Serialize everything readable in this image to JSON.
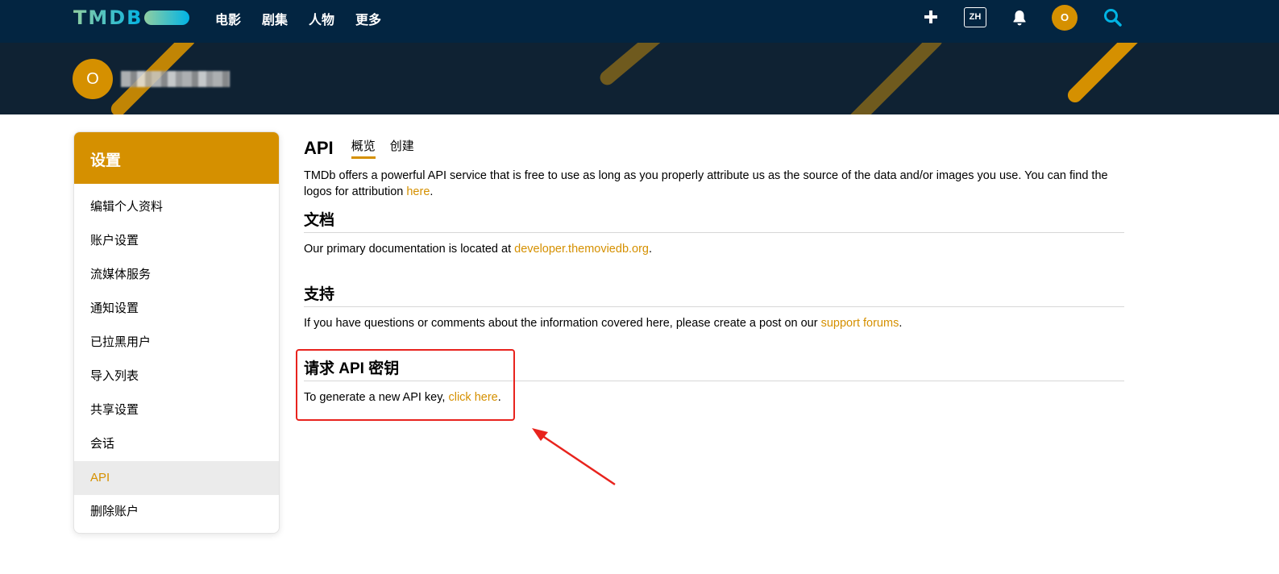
{
  "topnav": {
    "logo": "TMDB",
    "menu": [
      "电影",
      "剧集",
      "人物",
      "更多"
    ],
    "lang": "ZH",
    "avatar_initial": "O",
    "icons": [
      "plus-icon",
      "bell-icon",
      "search-icon"
    ]
  },
  "banner": {
    "avatar_initial": "O"
  },
  "sidebar": {
    "title": "设置",
    "items": [
      {
        "label": "编辑个人资料"
      },
      {
        "label": "账户设置"
      },
      {
        "label": "流媒体服务"
      },
      {
        "label": "通知设置"
      },
      {
        "label": "已拉黑用户"
      },
      {
        "label": "导入列表"
      },
      {
        "label": "共享设置"
      },
      {
        "label": "会话"
      },
      {
        "label": "API"
      },
      {
        "label": "删除账户"
      }
    ],
    "active_index": 8
  },
  "main": {
    "title": "API",
    "tabs": [
      {
        "label": "概览"
      },
      {
        "label": "创建"
      }
    ],
    "intro_text": "TMDb offers a powerful API service that is free to use as long as you properly attribute us as the source of the data and/or images you use. You can find the logos for attribution ",
    "intro_link": "here",
    "docs": {
      "heading": "文档",
      "text": "Our primary documentation is located at ",
      "link": "developer.themoviedb.org"
    },
    "support": {
      "heading": "支持",
      "text": "If you have questions or comments about the information covered here, please create a post on our ",
      "link": "support forums"
    },
    "request": {
      "heading": "请求 API 密钥",
      "text": "To generate a new API key, ",
      "link": "click here"
    }
  },
  "colors": {
    "nav_bg": "#032541",
    "accent": "#d59000",
    "annotation": "#e8231d"
  }
}
